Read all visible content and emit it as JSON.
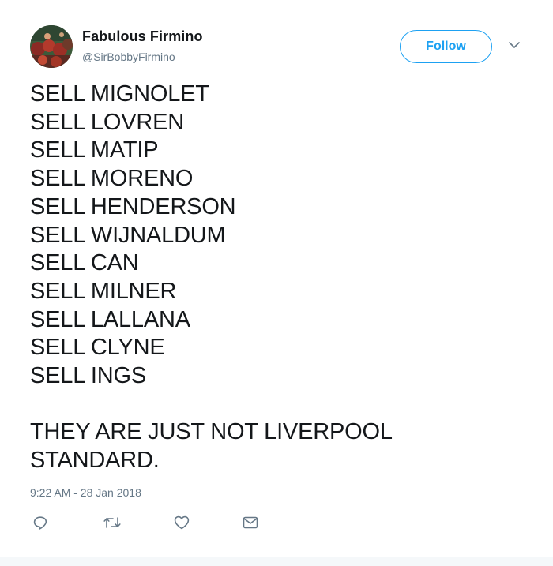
{
  "author": {
    "name": "Fabulous Firmino",
    "handle": "@SirBobbyFirmino",
    "avatar_icon": "profile-photo-icon"
  },
  "follow_label": "Follow",
  "tweet_lines": [
    "SELL MIGNOLET",
    "SELL LOVREN",
    "SELL MATIP",
    "SELL MORENO",
    "SELL HENDERSON",
    "SELL WIJNALDUM",
    "SELL CAN",
    "SELL MILNER",
    "SELL LALLANA",
    "SELL CLYNE",
    "SELL INGS"
  ],
  "tweet_closing": [
    "THEY ARE JUST NOT LIVERPOOL",
    "STANDARD."
  ],
  "timestamp": "9:22 AM - 28 Jan 2018",
  "actions": [
    {
      "icon": "reply-icon"
    },
    {
      "icon": "retweet-icon"
    },
    {
      "icon": "like-icon"
    },
    {
      "icon": "direct-message-icon"
    }
  ],
  "colors": {
    "accent": "#1da1f2",
    "text": "#14171a",
    "muted": "#657786",
    "icon": "#657786"
  }
}
